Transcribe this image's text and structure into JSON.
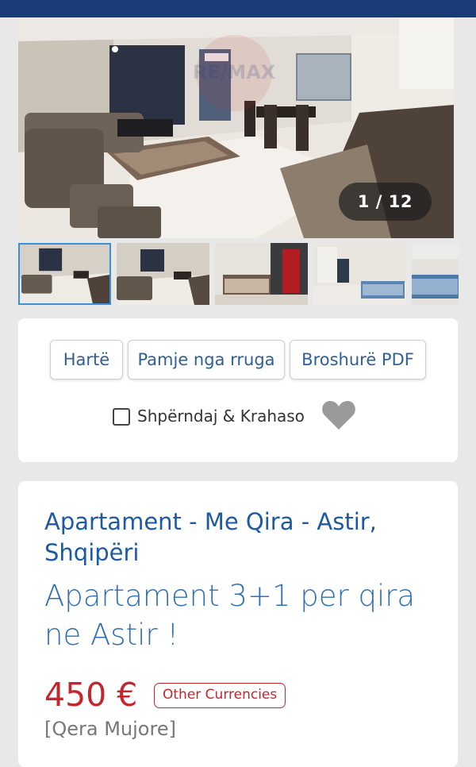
{
  "gallery": {
    "counter": "1 / 12",
    "watermark": "RE/MAX",
    "thumbnails": [
      "living-room-1",
      "living-room-2",
      "bedroom",
      "bedroom-2",
      "bedroom-3"
    ]
  },
  "actions": {
    "map_label": "Hartë",
    "street_view_label": "Pamje nga rruga",
    "brochure_label": "Broshurë PDF",
    "share_compare_label": "Shpërndaj & Krahaso",
    "favorite_icon": "heart-icon"
  },
  "listing": {
    "type_line": "Apartament - Me Qira - Astir, Shqipëri",
    "title": "Apartament 3+1 per qira ne Astir !",
    "price": "450 €",
    "currency_button": "Other Currencies",
    "period": "[Qera Mujore]"
  },
  "colors": {
    "header": "#1b3a78",
    "link_blue": "#2d5f98",
    "title_blue": "#2e6fb3",
    "price_red": "#c4262e",
    "active_thumb_border": "#3d8fd8"
  }
}
